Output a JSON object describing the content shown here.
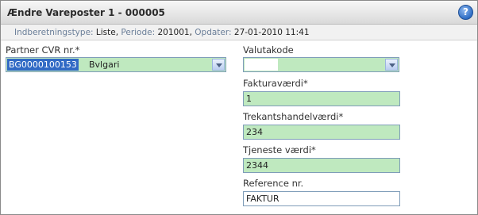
{
  "window": {
    "title": "Ændre Vareposter 1 - 000005",
    "help_icon": "help-icon",
    "help_glyph": "?"
  },
  "infobar": {
    "type_label": "Indberetningstype:",
    "type_value": "Liste,",
    "period_label": "Periode:",
    "period_value": "201001,",
    "updated_label": "Opdater:",
    "updated_value": "27-01-2010 11:41"
  },
  "form": {
    "partner": {
      "label": "Partner CVR nr.*",
      "code": "BG0000100153",
      "name": "Bvlgari"
    },
    "valuta": {
      "label": "Valutakode",
      "value": ""
    },
    "fakturavaerdi": {
      "label": "Fakturaværdi*",
      "value": "1"
    },
    "trekant": {
      "label": "Trekantshandelværdi*",
      "value": "234"
    },
    "tjeneste": {
      "label": "Tjeneste værdi*",
      "value": "2344"
    },
    "reference": {
      "label": "Reference nr.",
      "value": "FAKTUR"
    }
  },
  "colors": {
    "field_valid": "#bfe9bf",
    "selection": "#316ac5",
    "border": "#7f9db9"
  }
}
